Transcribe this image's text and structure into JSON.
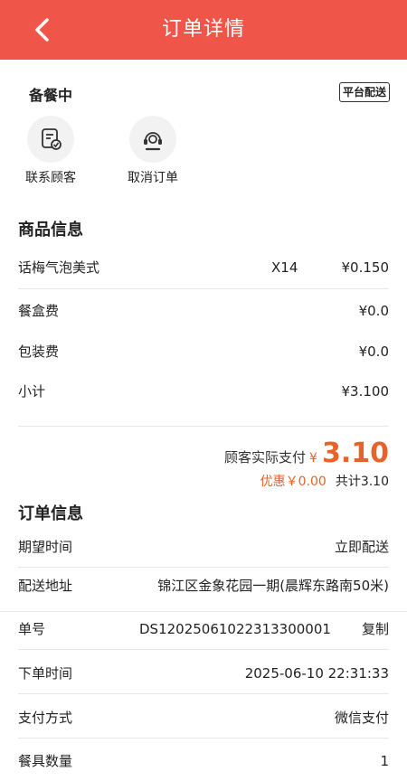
{
  "header": {
    "title": "订单详情"
  },
  "status": {
    "text": "备餐中",
    "tag": "平台配送"
  },
  "actions": [
    {
      "label": "联系顾客",
      "icon": "customer-document-icon"
    },
    {
      "label": "取消订单",
      "icon": "headset-support-icon"
    }
  ],
  "goods": {
    "title": "商品信息",
    "items": [
      {
        "name": "话梅气泡美式",
        "qty": "X14",
        "price": "¥0.150"
      }
    ],
    "fees": [
      {
        "label": "餐盒费",
        "value": "¥0.0"
      },
      {
        "label": "包装费",
        "value": "¥0.0"
      },
      {
        "label": "小计",
        "value": "¥3.100"
      }
    ],
    "paid_label": "顾客实际支付",
    "paid_symbol": "¥",
    "paid_amount": "3.10",
    "discount": "优惠￥0.00",
    "total": "共计3.10"
  },
  "order": {
    "title": "订单信息",
    "rows": [
      {
        "label": "期望时间",
        "value": "立即配送"
      },
      {
        "label": "配送地址",
        "value": "锦江区金象花园一期(晨辉东路南50米)"
      },
      {
        "label": "单号",
        "value": "DS12025061022313300001",
        "action": "复制"
      },
      {
        "label": "下单时间",
        "value": "2025-06-10 22:31:33"
      },
      {
        "label": "支付方式",
        "value": "微信支付"
      },
      {
        "label": "餐具数量",
        "value": "1"
      }
    ]
  },
  "colors": {
    "header": "#f0554a",
    "accent": "#e8622a"
  }
}
